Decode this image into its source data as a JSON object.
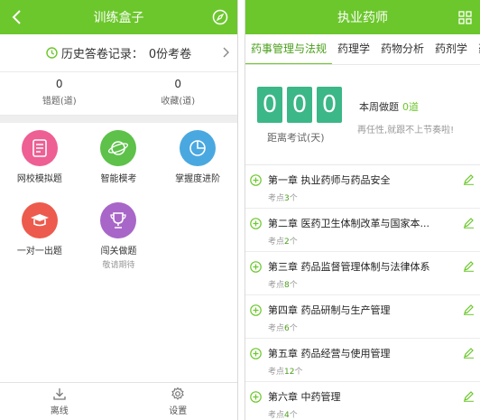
{
  "left_screen": {
    "title": "训练盒子",
    "history": {
      "label": "历史答卷记录：",
      "count": "0份考卷"
    },
    "stats": [
      {
        "value": "0",
        "label": "错题(道)"
      },
      {
        "value": "0",
        "label": "收藏(道)"
      }
    ],
    "tiles": [
      {
        "label": "网校模拟题",
        "sub": "",
        "color": "#ee5f93",
        "icon": "document-icon"
      },
      {
        "label": "智能模考",
        "sub": "",
        "color": "#5dc14a",
        "icon": "planet-icon"
      },
      {
        "label": "掌握度进阶",
        "sub": "",
        "color": "#4aa8e0",
        "icon": "pie-chart-icon"
      },
      {
        "label": "一对一出题",
        "sub": "",
        "color": "#ec5b4d",
        "icon": "graduation-cap-icon"
      },
      {
        "label": "闯关做题",
        "sub": "敬请期待",
        "color": "#a866c8",
        "icon": "trophy-icon"
      }
    ],
    "bottom_nav": [
      {
        "label": "离线",
        "icon": "download-icon"
      },
      {
        "label": "设置",
        "icon": "gear-icon"
      }
    ]
  },
  "right_screen": {
    "title": "执业药师",
    "tabs": [
      "药事管理与法规",
      "药理学",
      "药物分析",
      "药剂学",
      "药"
    ],
    "active_tab": 0,
    "digits": [
      "0",
      "0",
      "0"
    ],
    "countdown_label": "距离考试(天)",
    "week_label": "本周做题",
    "week_count": "0道",
    "encourage": "再任性,就跟不上节奏啦!",
    "points_prefix": "考点",
    "points_suffix": "个",
    "chapters": [
      {
        "title": "第一章 执业药师与药品安全",
        "points": "3"
      },
      {
        "title": "第二章 医药卫生体制改革与国家本...",
        "points": "2"
      },
      {
        "title": "第三章 药品监督管理体制与法律体系",
        "points": "8"
      },
      {
        "title": "第四章 药品研制与生产管理",
        "points": "6"
      },
      {
        "title": "第五章 药品经营与使用管理",
        "points": "12"
      },
      {
        "title": "第六章 中药管理",
        "points": "4"
      }
    ]
  },
  "colors": {
    "header_green": "#6cc72c",
    "digit_green": "#3cb787",
    "accent_green": "#4a9f1a"
  }
}
